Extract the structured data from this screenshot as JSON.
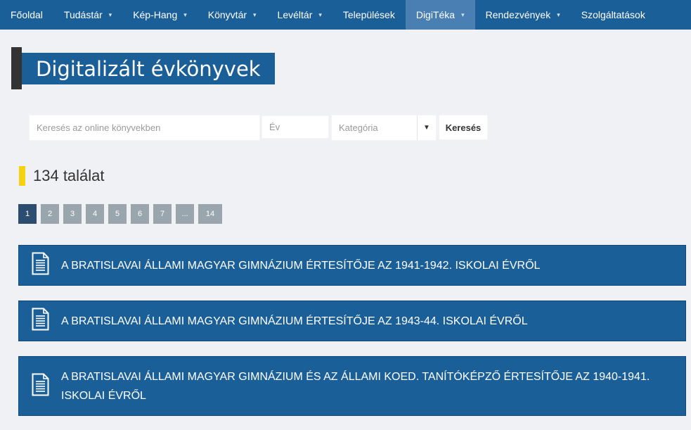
{
  "nav": {
    "items": [
      {
        "label": "Főoldal",
        "caret": false,
        "active": false
      },
      {
        "label": "Tudástár",
        "caret": true,
        "active": false
      },
      {
        "label": "Kép-Hang",
        "caret": true,
        "active": false
      },
      {
        "label": "Könyvtár",
        "caret": true,
        "active": false
      },
      {
        "label": "Levéltár",
        "caret": true,
        "active": false
      },
      {
        "label": "Települések",
        "caret": false,
        "active": false
      },
      {
        "label": "DigiTéka",
        "caret": true,
        "active": true
      },
      {
        "label": "Rendezvények",
        "caret": true,
        "active": false
      },
      {
        "label": "Szolgáltatások",
        "caret": false,
        "active": false
      }
    ],
    "caret_glyph": "▾"
  },
  "page_title": "Digitalizált évkönyvek",
  "search": {
    "query_placeholder": "Keresés az online könyvekben",
    "year_placeholder": "Év",
    "category_placeholder": "Kategória",
    "category_arrow": "▼",
    "submit_label": "Keresés"
  },
  "results": {
    "count_text": "134 találat",
    "pagination": [
      "1",
      "2",
      "3",
      "4",
      "5",
      "6",
      "7",
      "...",
      "14"
    ],
    "current_page": "1",
    "items": [
      {
        "title": "A BRATISLAVAI ÁLLAMI MAGYAR GIMNÁZIUM ÉRTESÍTŐJE AZ 1941-1942. ISKOLAI ÉVRŐL"
      },
      {
        "title": "A BRATISLAVAI ÁLLAMI MAGYAR GIMNÁZIUM ÉRTESÍTŐJE AZ 1943-44. ISKOLAI ÉVRŐL"
      },
      {
        "title": "A BRATISLAVAI ÁLLAMI MAGYAR GIMNÁZIUM ÉS AZ ÁLLAMI KOED. TANÍTÓKÉPZŐ ÉRTESÍTŐJE AZ 1940-1941. ISKOLAI ÉVRŐL"
      }
    ],
    "item_icon": "document-icon"
  },
  "colors": {
    "primary": "#1b5f98",
    "nav_active": "#4a7fb3",
    "accent_yellow": "#f5d20f",
    "page_inactive": "#9aa6ad",
    "page_active": "#2c4d70"
  }
}
